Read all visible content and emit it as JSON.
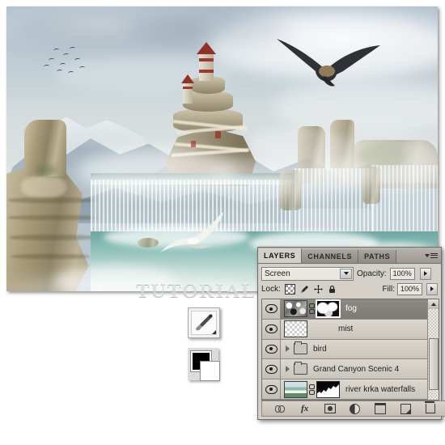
{
  "app": "Adobe Photoshop",
  "canvas": {
    "name": "composite-artwork",
    "description": "Fantasy photo composite: misty mountain range, rock citadel tower, waterfalls and canyon cliffs, eagle and seagull in flight",
    "watermark": "TUTORIAL LOUNGE"
  },
  "tools": {
    "brush_tool_label": "Brush Tool",
    "foreground_color": "#000000",
    "background_color": "#ffffff"
  },
  "panel": {
    "tabs": [
      {
        "label": "LAYERS",
        "active": true
      },
      {
        "label": "CHANNELS",
        "active": false
      },
      {
        "label": "PATHS",
        "active": false
      }
    ],
    "menu_icon": "panel-menu-icon",
    "blend_mode": "Screen",
    "opacity_label": "Opacity:",
    "opacity_value": "100%",
    "fill_label": "Fill:",
    "fill_value": "100%",
    "lock_label": "Lock:",
    "lock_icons": [
      "lock-transparent-pixels-icon",
      "lock-image-pixels-icon",
      "lock-position-icon",
      "lock-all-icon"
    ],
    "layers": [
      {
        "name": "fog",
        "visible": true,
        "selected": true,
        "type": "layer",
        "has_thumb": true,
        "has_mask": true,
        "mask_selected": true,
        "linked": true
      },
      {
        "name": "mist",
        "visible": true,
        "selected": false,
        "type": "layer",
        "has_thumb": true,
        "has_mask": false,
        "mask_selected": false,
        "linked": false
      },
      {
        "name": "bird",
        "visible": true,
        "selected": false,
        "type": "group",
        "has_thumb": false,
        "has_mask": false,
        "mask_selected": false,
        "linked": false
      },
      {
        "name": "Grand Canyon Scenic 4",
        "visible": true,
        "selected": false,
        "type": "group",
        "has_thumb": false,
        "has_mask": false,
        "mask_selected": false,
        "linked": false
      },
      {
        "name": "river krka waterfalls",
        "visible": true,
        "selected": false,
        "type": "layer",
        "has_thumb": true,
        "has_mask": true,
        "mask_selected": false,
        "linked": true
      }
    ],
    "bottom_buttons": [
      {
        "icon": "link-layers-icon",
        "title": "Link layers"
      },
      {
        "icon": "layer-style-fx-icon",
        "title": "Add a layer style",
        "glyph": "fx"
      },
      {
        "icon": "add-layer-mask-icon",
        "title": "Add layer mask"
      },
      {
        "icon": "adjustment-layer-icon",
        "title": "Create new fill or adjustment layer"
      },
      {
        "icon": "new-group-icon",
        "title": "Create a new group"
      },
      {
        "icon": "new-layer-icon",
        "title": "Create a new layer"
      },
      {
        "icon": "delete-layer-icon",
        "title": "Delete layer"
      }
    ],
    "scrollbar": {
      "up_arrow": "scroll-up-icon"
    }
  }
}
